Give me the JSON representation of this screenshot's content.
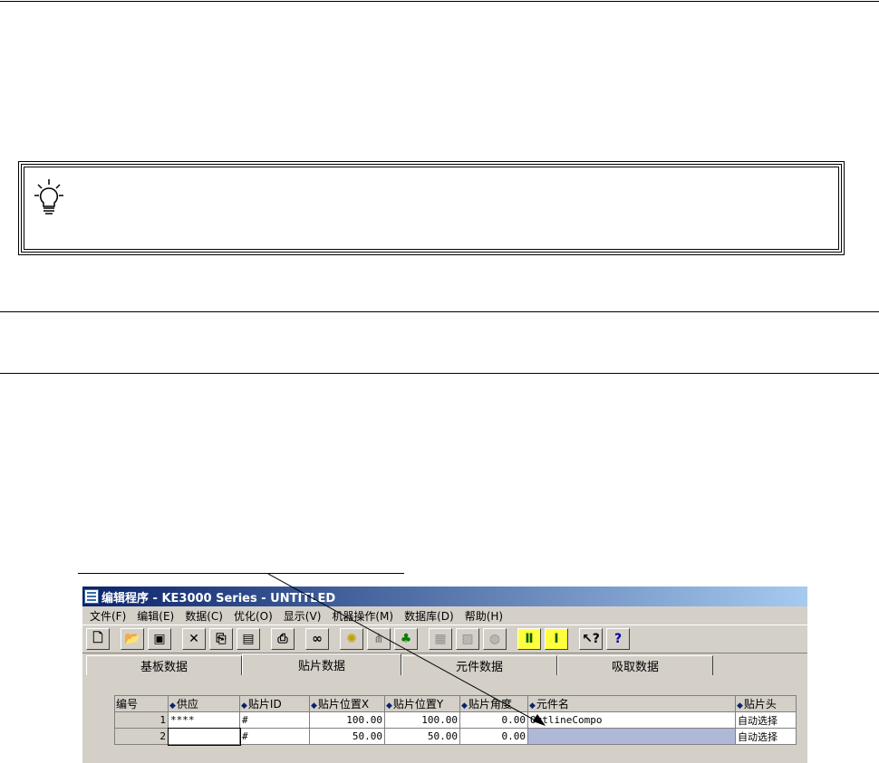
{
  "window": {
    "title": "编辑程序 - KE3000 Series - UNTITLED",
    "menu": [
      "文件(F)",
      "编辑(E)",
      "数据(C)",
      "优化(O)",
      "显示(V)",
      "机器操作(M)",
      "数据库(D)",
      "帮助(H)"
    ],
    "toolbar_icons": [
      "new-icon",
      "open-icon",
      "save-icon",
      "delete-icon",
      "copy-icon",
      "paste-icon",
      "print-icon",
      "find-icon",
      "bulb-icon",
      "tree-icon",
      "group-icon",
      "disabled-icon-1",
      "disabled-icon-2",
      "disabled-icon-3",
      "nozzle-icon-1",
      "nozzle-icon-2",
      "context-help-icon",
      "help-icon"
    ],
    "tabs": [
      "基板数据",
      "贴片数据",
      "元件数据",
      "吸取数据"
    ],
    "active_tab": "贴片数据",
    "columns": [
      "编号",
      "供应",
      "贴片ID",
      "贴片位置X",
      "贴片位置Y",
      "贴片角度",
      "元件名",
      "贴片头"
    ],
    "rows": [
      {
        "no": "1",
        "feeder": "****",
        "id": "#",
        "x": "100.00",
        "y": "100.00",
        "angle": "0.00",
        "part": "OutlineCompo",
        "head": "自动选择"
      },
      {
        "no": "2",
        "feeder": "",
        "id": "#",
        "x": "50.00",
        "y": "50.00",
        "angle": "0.00",
        "part": "",
        "head": "自动选择"
      }
    ]
  },
  "colors": {
    "title_start": "#0a246a",
    "title_end": "#a6caf0",
    "face": "#d4d0c8",
    "selection": "#b0b8d8"
  }
}
